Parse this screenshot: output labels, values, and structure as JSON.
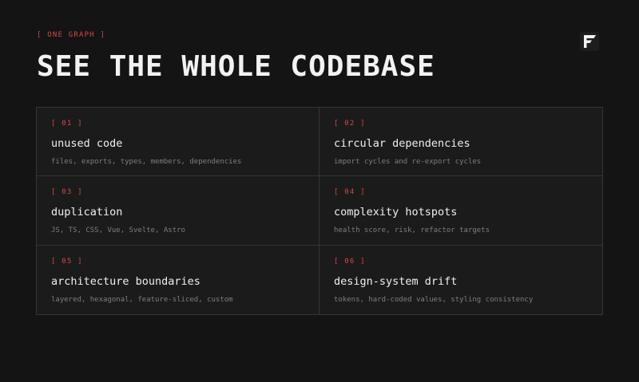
{
  "header": {
    "eyebrow": "[ ONE GRAPH ]",
    "title": "SEE THE WHOLE CODEBASE"
  },
  "logo": {
    "icon": "brand-f-logo-icon"
  },
  "colors": {
    "accent": "#d14a45",
    "background": "#141414",
    "panel": "#1b1b1b",
    "border": "#353535"
  },
  "features": [
    {
      "number": "[ 01 ]",
      "label": "unused code",
      "desc": "files, exports, types, members, dependencies"
    },
    {
      "number": "[ 02 ]",
      "label": "circular dependencies",
      "desc": "import cycles and re-export cycles"
    },
    {
      "number": "[ 03 ]",
      "label": "duplication",
      "desc": "JS, TS, CSS, Vue, Svelte, Astro"
    },
    {
      "number": "[ 04 ]",
      "label": "complexity hotspots",
      "desc": "health score, risk, refactor targets"
    },
    {
      "number": "[ 05 ]",
      "label": "architecture boundaries",
      "desc": "layered, hexagonal, feature-sliced, custom"
    },
    {
      "number": "[ 06 ]",
      "label": "design-system drift",
      "desc": "tokens, hard-coded values, styling consistency"
    }
  ]
}
